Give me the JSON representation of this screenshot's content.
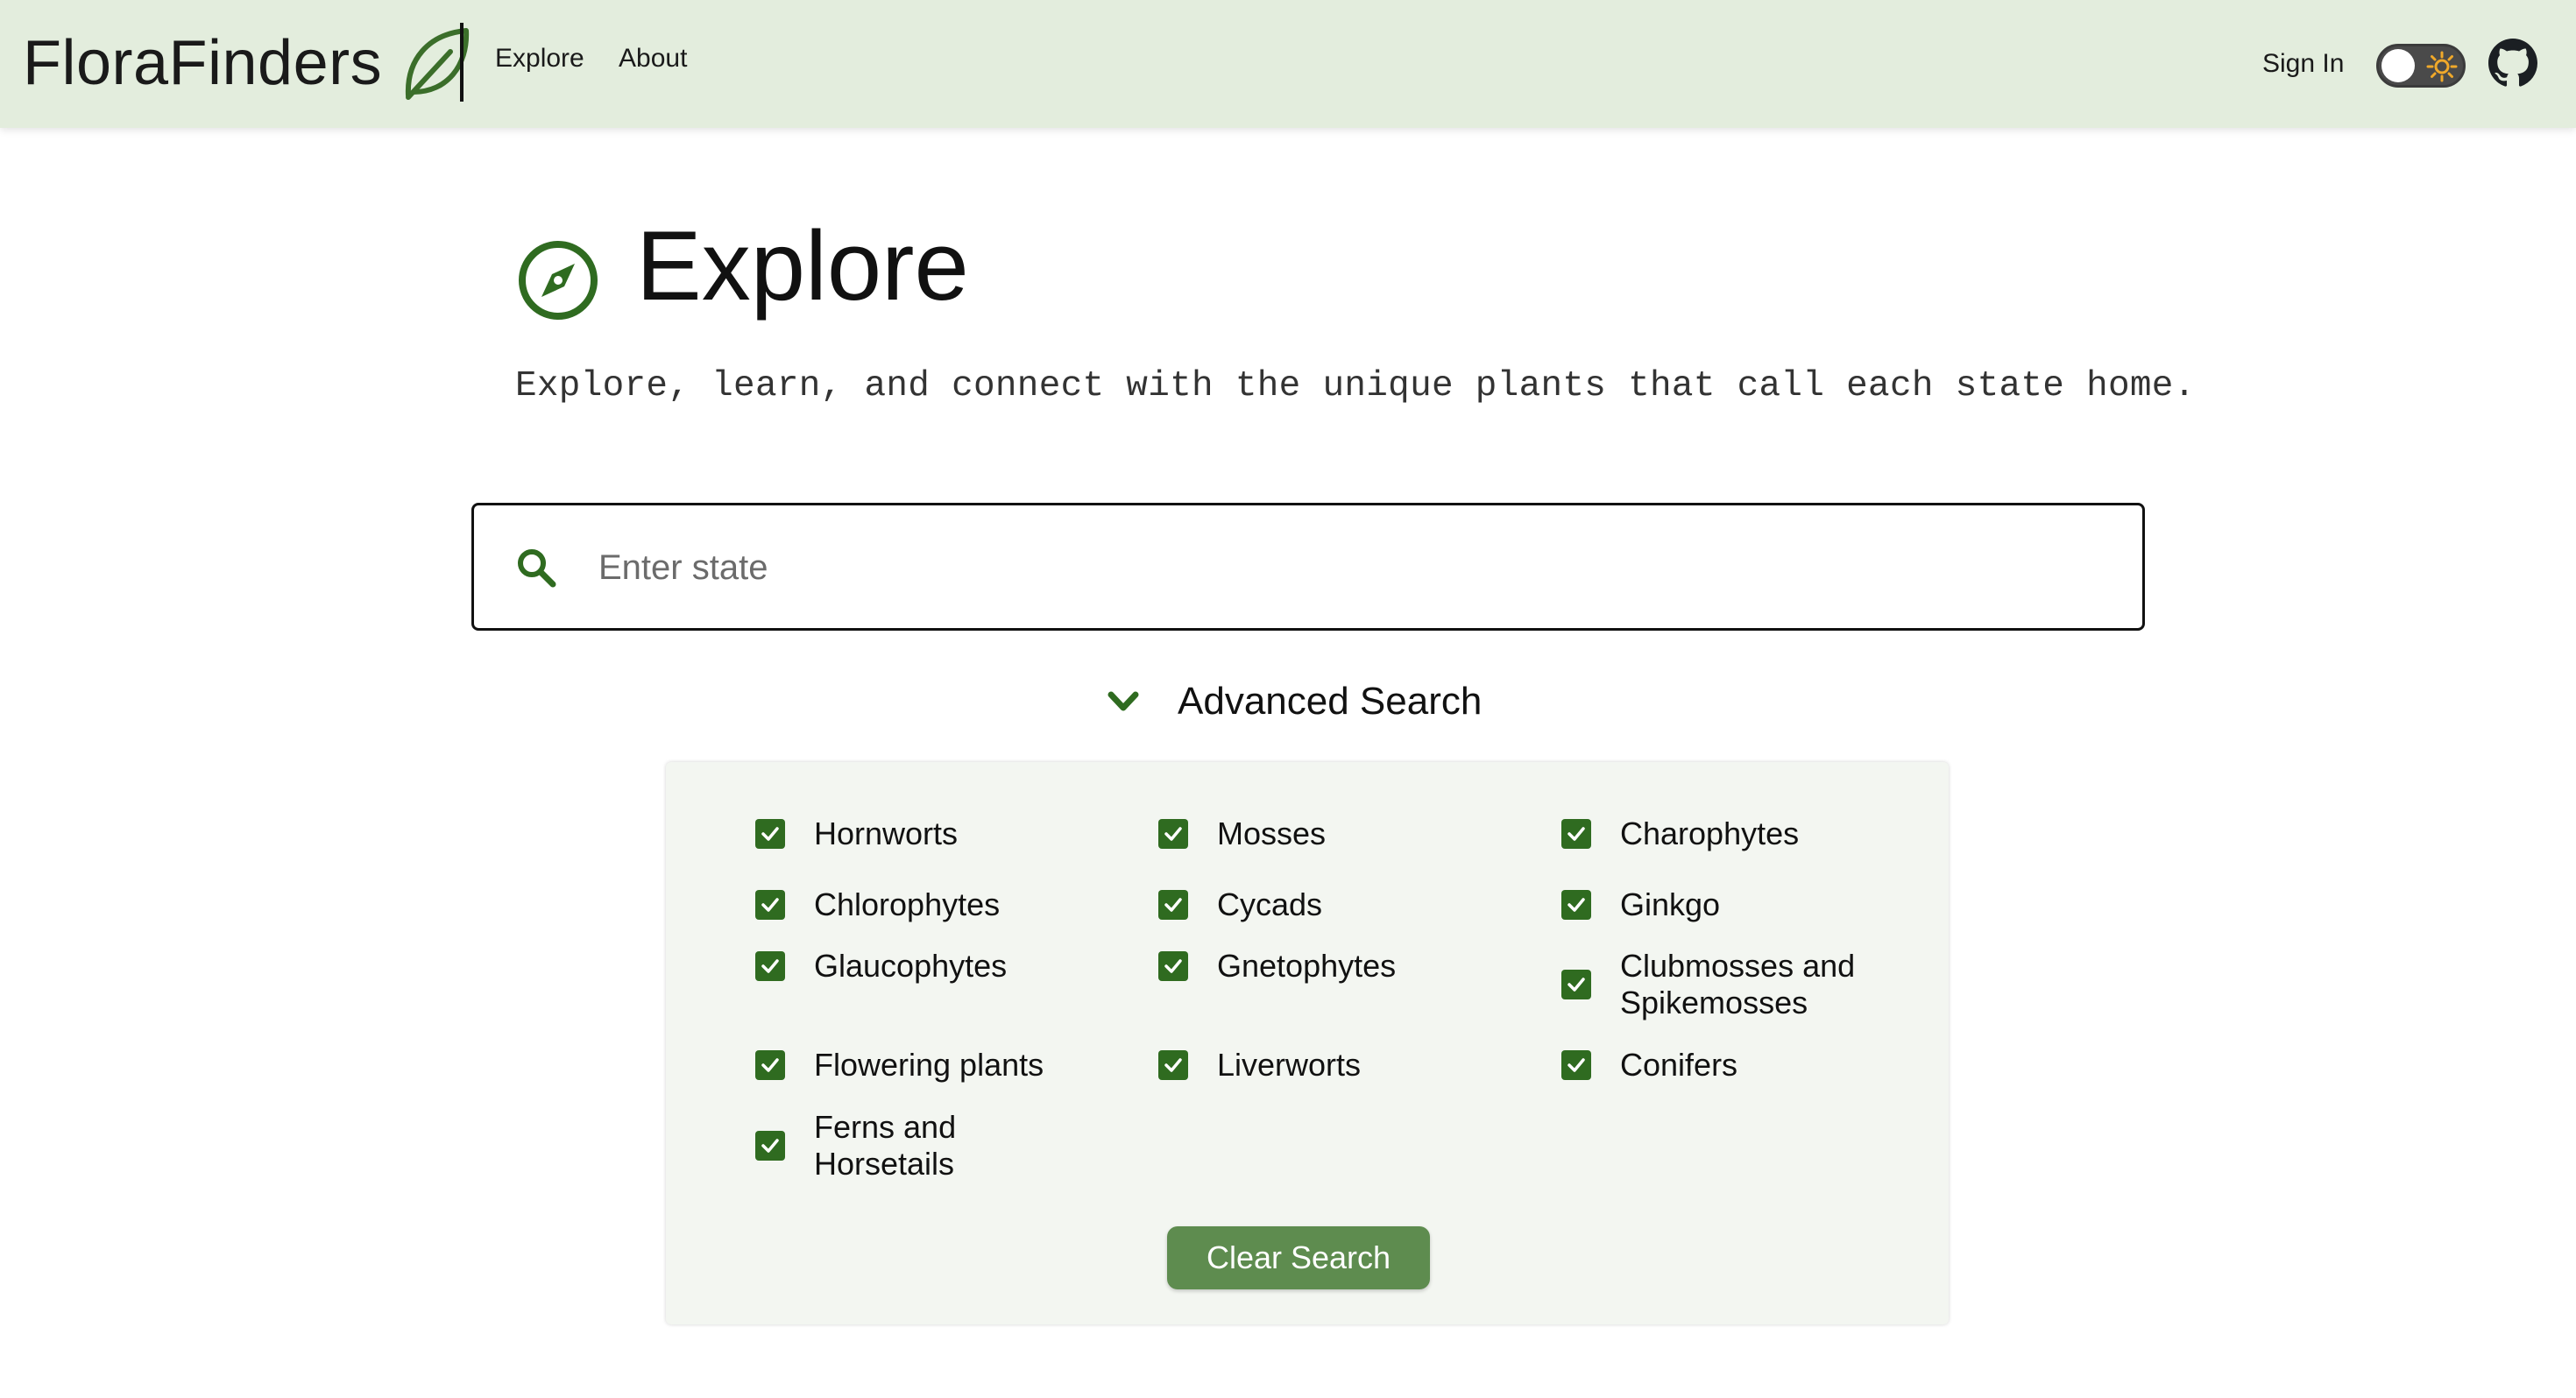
{
  "nav": {
    "brand": "FloraFinders",
    "links": [
      "Explore",
      "About"
    ],
    "sign_in": "Sign In"
  },
  "header": {
    "title": "Explore",
    "subtitle": "Explore, learn, and connect with the unique plants that call each state home."
  },
  "search": {
    "placeholder": "Enter state",
    "value": "",
    "advanced_label": "Advanced Search"
  },
  "filters": [
    {
      "label": "Hornworts",
      "checked": true
    },
    {
      "label": "Mosses",
      "checked": true
    },
    {
      "label": "Charophytes",
      "checked": true
    },
    {
      "label": "Chlorophytes",
      "checked": true
    },
    {
      "label": "Cycads",
      "checked": true
    },
    {
      "label": "Ginkgo",
      "checked": true
    },
    {
      "label": "Glaucophytes",
      "checked": true
    },
    {
      "label": "Gnetophytes",
      "checked": true
    },
    {
      "label": "Clubmosses and Spikemosses",
      "checked": true
    },
    {
      "label": "Flowering plants",
      "checked": true
    },
    {
      "label": "Liverworts",
      "checked": true
    },
    {
      "label": "Conifers",
      "checked": true
    },
    {
      "label": "Ferns and Horsetails",
      "checked": true
    }
  ],
  "clear_button": "Clear Search",
  "theme": {
    "navbar_bg": "#e3eddd",
    "accent": "#2f6b20",
    "button_bg": "#5e8c4f",
    "toggle_state": "light"
  },
  "icons": [
    "leaf-icon",
    "sun-icon",
    "github-icon",
    "compass-icon",
    "search-icon",
    "chevron-down-icon",
    "checkbox-checked-icon"
  ]
}
